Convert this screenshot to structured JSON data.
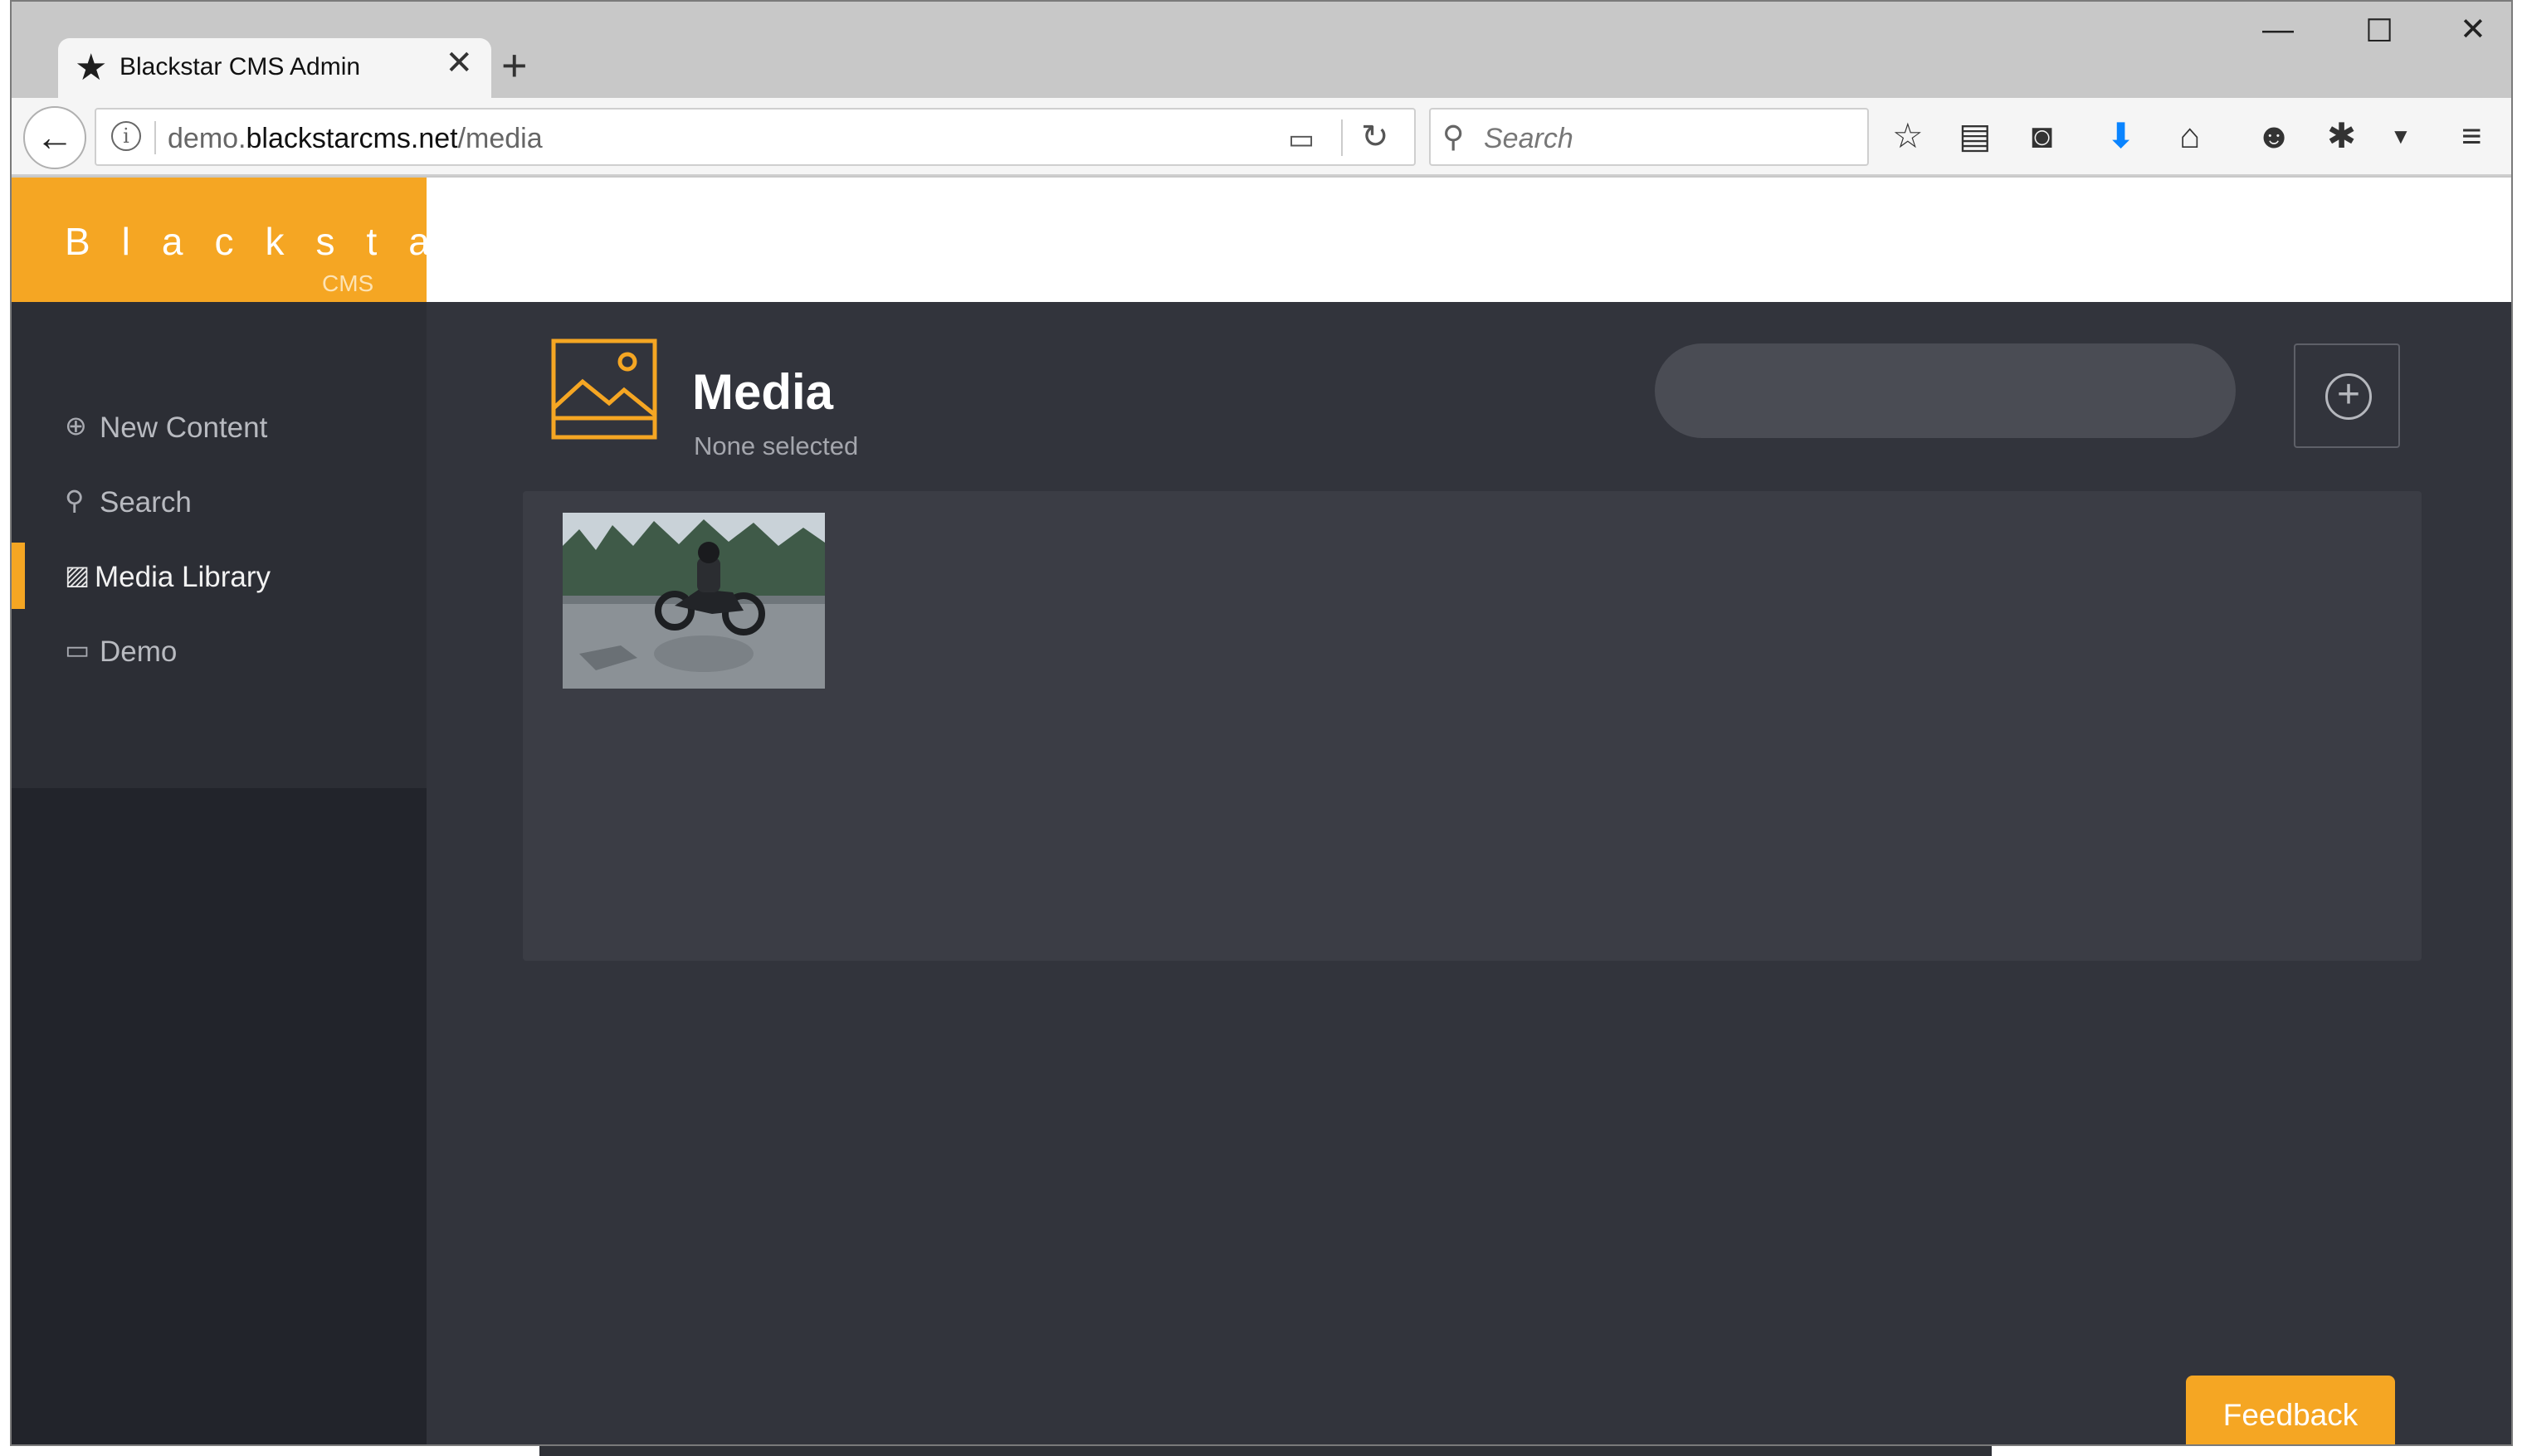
{
  "browser": {
    "tab_title": "Blackstar CMS Admin",
    "new_tab_symbol": "+",
    "url_prefix": "demo.",
    "url_host": "blackstarcms.net",
    "url_path": "/media",
    "search_placeholder": "Search"
  },
  "icons": {
    "tab": "star-icon",
    "toolbar": [
      "bookmark-star-icon",
      "reading-list-icon",
      "pocket-icon",
      "download-icon",
      "home-icon",
      "chat-icon",
      "extension-icon",
      "menu-icon"
    ]
  },
  "app": {
    "brand": "Blackstar",
    "brand_sub": "CMS",
    "sidebar": {
      "items": [
        {
          "label": "New Content",
          "icon": "plus-circle-icon",
          "active": false
        },
        {
          "label": "Search",
          "icon": "search-icon",
          "active": false
        },
        {
          "label": "Media Library",
          "icon": "image-icon",
          "active": true
        },
        {
          "label": "Demo",
          "icon": "monitor-icon",
          "active": false
        }
      ]
    },
    "page": {
      "title": "Media",
      "subtitle": "None selected"
    },
    "gallery": {
      "items": [
        {
          "alt": "motorcycle-rider-image"
        }
      ]
    },
    "feedback_label": "Feedback"
  },
  "colors": {
    "accent": "#f5a623",
    "app_bg": "#32343c",
    "sidebar_bg": "#2c2e35",
    "download_blue": "#0a84ff"
  }
}
